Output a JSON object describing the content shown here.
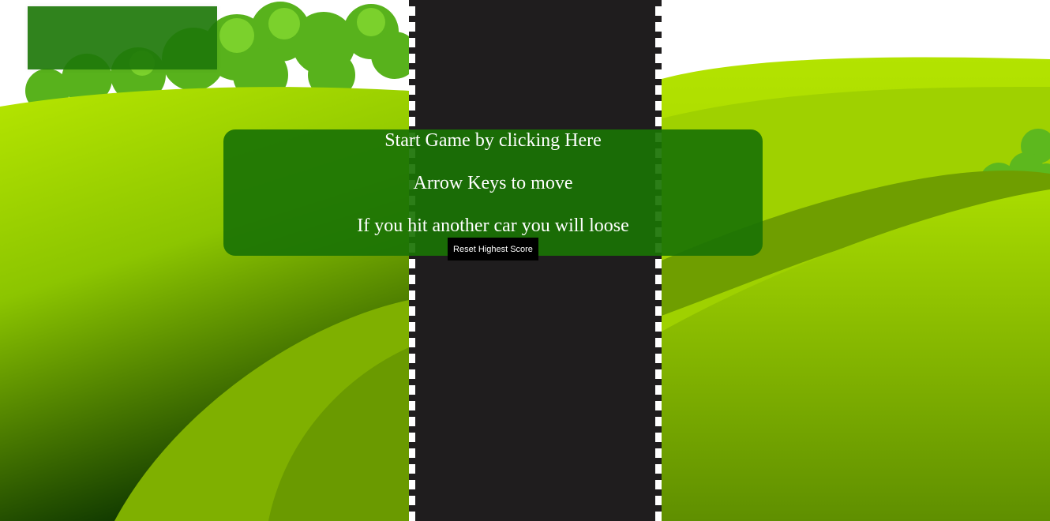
{
  "score_panel": {
    "text": ""
  },
  "start_panel": {
    "line1": "Start Game by clicking Here",
    "line2": "Arrow Keys to move",
    "line3": "If you hit another car you will loose"
  },
  "reset_button": {
    "label": "Reset Highest Score"
  },
  "colors": {
    "road": "#1f1d1e",
    "road_edge": "#ffffff",
    "panel": "#1a7304",
    "grass_light": "#b0e400",
    "grass_dark": "#113a00",
    "bush": "#4fae1a"
  }
}
